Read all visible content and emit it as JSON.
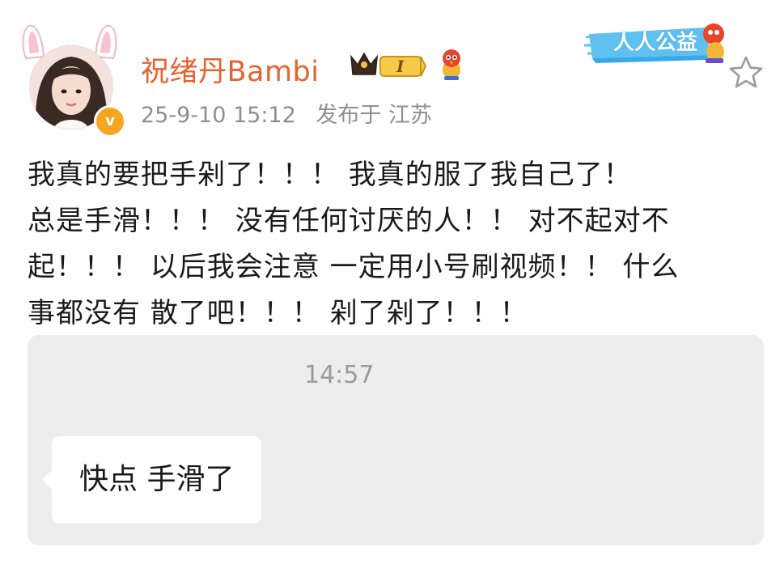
{
  "post": {
    "author": {
      "name": "祝绪丹Bambi",
      "verified_mark": "v",
      "vip_level": "I",
      "name_color": "#e8622f"
    },
    "timestamp": "25-9-10 15:12",
    "location": "发布于 江苏",
    "charity_badge": "人人公益",
    "text_lines": [
      "我真的要把手剁了！！！ 我真的服了我自己了！",
      "总是手滑！！！ 没有任何讨厌的人！！ 对不起对不",
      "起！！！ 以后我会注意 一定用小号刷视频！！ 什么",
      "事都没有 散了吧！！！ 剁了剁了！！！"
    ],
    "image": {
      "chat_time": "14:57",
      "bubble_text": "快点 手滑了"
    }
  },
  "icons": {
    "star": "star-icon",
    "crown": "crown-icon",
    "bird": "bird-mascot-icon",
    "bunny_ears": "bunny-ears"
  },
  "colors": {
    "accent": "#e8622f",
    "meta": "#8f8f8f",
    "image_bg": "#ededed",
    "verified": "#f6a623"
  }
}
